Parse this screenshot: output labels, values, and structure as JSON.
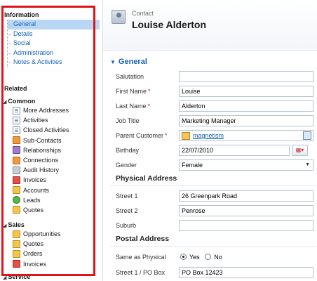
{
  "sidebar": {
    "information_title": "Information",
    "information_items": [
      "General",
      "Details",
      "Social",
      "Administration",
      "Notes & Activities"
    ],
    "related_title": "Related",
    "common": {
      "title": "Common",
      "items": [
        {
          "label": "More Addresses",
          "icon": "addresses-icon"
        },
        {
          "label": "Activities",
          "icon": "activities-icon"
        },
        {
          "label": "Closed Activities",
          "icon": "closed-activities-icon"
        },
        {
          "label": "Sub-Contacts",
          "icon": "sub-contacts-icon"
        },
        {
          "label": "Relationships",
          "icon": "relationships-icon"
        },
        {
          "label": "Connections",
          "icon": "connections-icon"
        },
        {
          "label": "Audit History",
          "icon": "audit-history-icon"
        },
        {
          "label": "Invoices",
          "icon": "invoices-icon"
        },
        {
          "label": "Accounts",
          "icon": "accounts-icon"
        },
        {
          "label": "Leads",
          "icon": "leads-icon"
        },
        {
          "label": "Quotes",
          "icon": "quotes-icon"
        }
      ]
    },
    "sales": {
      "title": "Sales",
      "items": [
        {
          "label": "Opportunities",
          "icon": "opportunities-icon"
        },
        {
          "label": "Quotes",
          "icon": "quotes-icon"
        },
        {
          "label": "Orders",
          "icon": "orders-icon"
        },
        {
          "label": "Invoices",
          "icon": "invoices-icon"
        }
      ]
    },
    "service_title": "Service",
    "highlight_color": "#e0121b"
  },
  "header": {
    "entity": "Contact",
    "record_name": "Louise Alderton"
  },
  "form": {
    "section_title": "General",
    "salutation": {
      "label": "Salutation",
      "value": ""
    },
    "first_name": {
      "label": "First Name",
      "value": "Louise"
    },
    "last_name": {
      "label": "Last Name",
      "value": "Alderton"
    },
    "job_title": {
      "label": "Job Title",
      "value": "Marketing Manager"
    },
    "parent_customer": {
      "label": "Parent Customer",
      "value": "magnetism"
    },
    "birthday": {
      "label": "Birthday",
      "value": "22/07/2010"
    },
    "gender": {
      "label": "Gender",
      "value": "Female"
    },
    "physical_address_title": "Physical Address",
    "street1": {
      "label": "Street 1",
      "value": "26 Greenpark Road"
    },
    "street2": {
      "label": "Street 2",
      "value": "Penrose"
    },
    "suburb": {
      "label": "Suburb",
      "value": ""
    },
    "postal_address_title": "Postal Address",
    "same_as_physical": {
      "label": "Same as Physical",
      "yes": "Yes",
      "no": "No",
      "selected": "Yes"
    },
    "po_box": {
      "label": "Street 1 / PO Box",
      "value": "PO Box 12423"
    }
  },
  "colors": {
    "link": "#1560b8",
    "required": "#cf1c1c",
    "selected_bg": "#b9d7f5"
  }
}
